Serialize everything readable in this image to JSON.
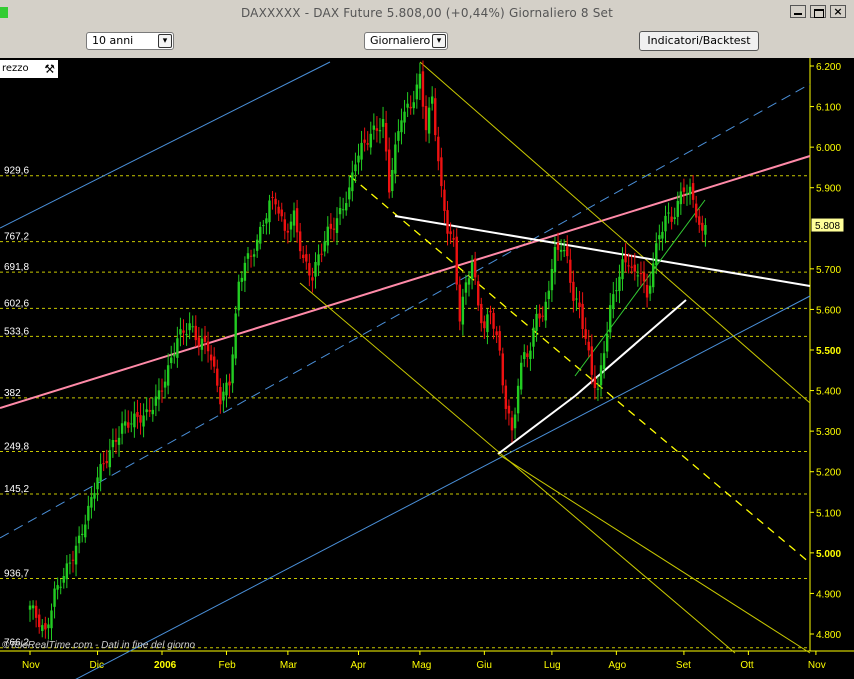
{
  "window": {
    "title": "DAXXXXX - DAX Future    5.808,00 (+0,44%)    Giornaliero  8 Set",
    "buttons": [
      "minimize-icon",
      "restore-icon",
      "close-icon"
    ]
  },
  "toolbar": {
    "period_value": "10 anni",
    "interval_value": "Giornaliero",
    "indicators_label": "Indicatori/Backtest",
    "arrow": "▾"
  },
  "panel": {
    "tag_label": "rezzo",
    "tag_icon": "wrench-icon",
    "watermark": "©TeleRealTime.com - Dati in fine del giorno"
  },
  "chart_data": {
    "type": "candlestick",
    "title": "DAX Future",
    "price_axis": {
      "range": [
        4750,
        6210
      ],
      "ticks": [
        "6.200",
        "6.100",
        "6.000",
        "5.900",
        "5.800",
        "5.700",
        "5.600",
        "5.500",
        "5.400",
        "5.300",
        "5.200",
        "5.100",
        "5.000",
        "4.900",
        "4.800"
      ],
      "tick_values": [
        6200,
        6100,
        6000,
        5900,
        5800,
        5700,
        5600,
        5500,
        5400,
        5300,
        5200,
        5100,
        5000,
        4900,
        4800
      ]
    },
    "last_price": {
      "label": "5.808",
      "value": 5808
    },
    "levels": [
      {
        "label": "929,6",
        "value": 5929.6
      },
      {
        "label": "767,2",
        "value": 5767.2
      },
      {
        "label": "691,8",
        "value": 5691.8
      },
      {
        "label": "602,6",
        "value": 5602.6
      },
      {
        "label": "533,6",
        "value": 5533.6
      },
      {
        "label": "382",
        "value": 5382
      },
      {
        "label": "249,8",
        "value": 5249.8
      },
      {
        "label": "145,2",
        "value": 5145.2
      },
      {
        "label": "936,7",
        "value": 4936.7
      },
      {
        "label": "766,2",
        "value": 4766.2
      }
    ],
    "months": [
      "Nov",
      "Dic",
      "2006",
      "Feb",
      "Mar",
      "Apr",
      "Mag",
      "Giu",
      "Lug",
      "Ago",
      "Set",
      "Ott",
      "Nov"
    ],
    "month_index": [
      0,
      22,
      43,
      64,
      84,
      107,
      127,
      148,
      170,
      191,
      213,
      234,
      256
    ],
    "bold_month": "2006",
    "closes_anchor": [
      [
        0,
        4870
      ],
      [
        3,
        4830
      ],
      [
        5,
        4800
      ],
      [
        8,
        4900
      ],
      [
        12,
        4960
      ],
      [
        16,
        5030
      ],
      [
        20,
        5130
      ],
      [
        22,
        5190
      ],
      [
        26,
        5250
      ],
      [
        30,
        5310
      ],
      [
        34,
        5330
      ],
      [
        38,
        5340
      ],
      [
        42,
        5390
      ],
      [
        45,
        5450
      ],
      [
        48,
        5530
      ],
      [
        52,
        5560
      ],
      [
        55,
        5520
      ],
      [
        58,
        5510
      ],
      [
        62,
        5380
      ],
      [
        65,
        5420
      ],
      [
        68,
        5660
      ],
      [
        70,
        5720
      ],
      [
        72,
        5730
      ],
      [
        75,
        5790
      ],
      [
        78,
        5860
      ],
      [
        80,
        5870
      ],
      [
        83,
        5790
      ],
      [
        86,
        5830
      ],
      [
        89,
        5720
      ],
      [
        92,
        5680
      ],
      [
        94,
        5730
      ],
      [
        97,
        5790
      ],
      [
        100,
        5820
      ],
      [
        104,
        5890
      ],
      [
        106,
        5970
      ],
      [
        109,
        6010
      ],
      [
        112,
        6040
      ],
      [
        115,
        6060
      ],
      [
        117,
        5900
      ],
      [
        118,
        5950
      ],
      [
        121,
        6080
      ],
      [
        124,
        6100
      ],
      [
        127,
        6170
      ],
      [
        129,
        6050
      ],
      [
        131,
        6120
      ],
      [
        134,
        5890
      ],
      [
        136,
        5800
      ],
      [
        138,
        5760
      ],
      [
        140,
        5580
      ],
      [
        142,
        5660
      ],
      [
        144,
        5720
      ],
      [
        146,
        5610
      ],
      [
        148,
        5550
      ],
      [
        150,
        5600
      ],
      [
        153,
        5490
      ],
      [
        155,
        5360
      ],
      [
        157,
        5300
      ],
      [
        159,
        5410
      ],
      [
        161,
        5500
      ],
      [
        163,
        5490
      ],
      [
        165,
        5600
      ],
      [
        167,
        5570
      ],
      [
        169,
        5660
      ],
      [
        171,
        5740
      ],
      [
        173,
        5760
      ],
      [
        175,
        5720
      ],
      [
        177,
        5630
      ],
      [
        179,
        5600
      ],
      [
        181,
        5530
      ],
      [
        183,
        5440
      ],
      [
        185,
        5400
      ],
      [
        187,
        5500
      ],
      [
        189,
        5600
      ],
      [
        191,
        5660
      ],
      [
        193,
        5710
      ],
      [
        195,
        5720
      ],
      [
        197,
        5680
      ],
      [
        199,
        5700
      ],
      [
        201,
        5620
      ],
      [
        203,
        5720
      ],
      [
        205,
        5780
      ],
      [
        207,
        5830
      ],
      [
        209,
        5820
      ],
      [
        211,
        5860
      ],
      [
        213,
        5900
      ],
      [
        215,
        5890
      ],
      [
        217,
        5840
      ],
      [
        219,
        5780
      ],
      [
        220,
        5808
      ]
    ],
    "total_bars": 221
  }
}
